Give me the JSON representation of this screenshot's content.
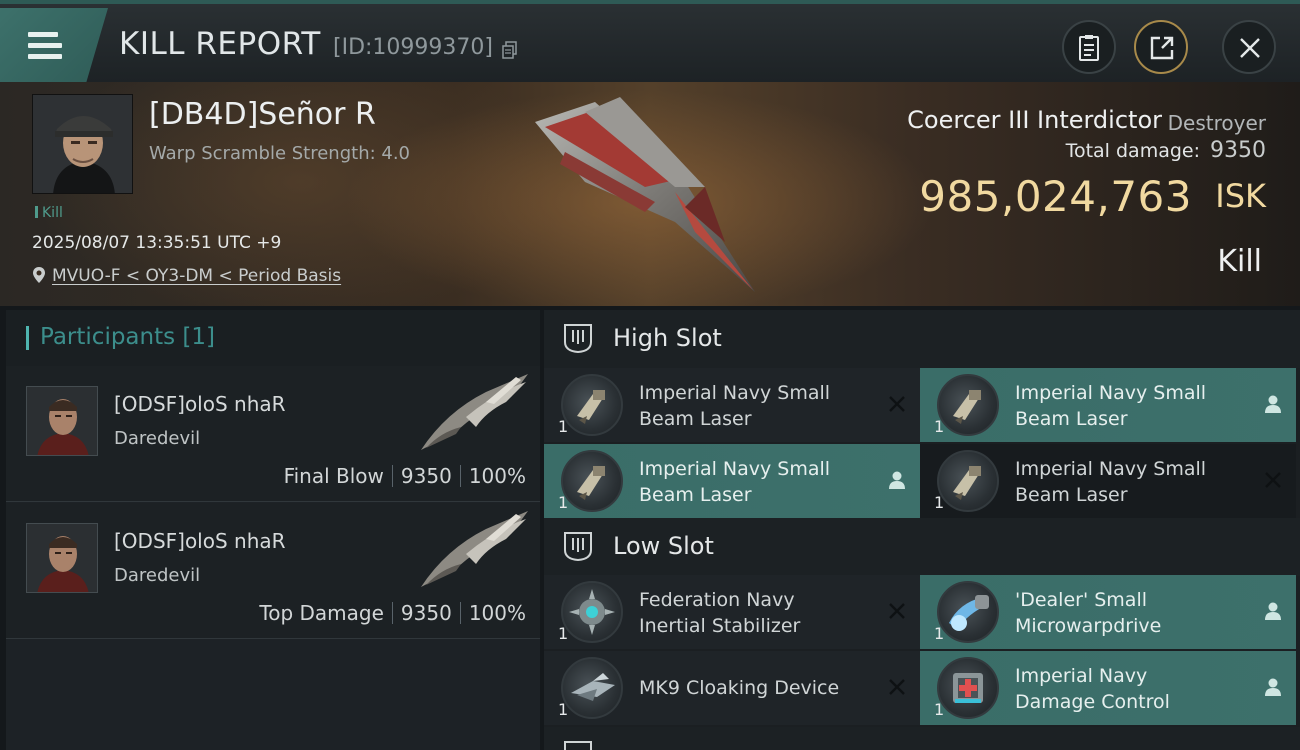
{
  "header": {
    "title": "KILL REPORT",
    "report_id": "[ID:10999370]"
  },
  "victim": {
    "name": "[DB4D]Señor R",
    "warp_scramble": "Warp Scramble Strength: 4.0",
    "tag": "Kill",
    "datetime": "2025/08/07 13:35:51 UTC +9",
    "location": "MVUO-F < OY3-DM < Period Basis",
    "ship_name": "Coercer III Interdictor",
    "ship_class": "Destroyer",
    "total_damage_label": "Total damage:",
    "total_damage": "9350",
    "isk_value": "985,024,763",
    "isk_unit": "ISK",
    "report_type": "Kill"
  },
  "participants": {
    "header": "Participants [1]",
    "rows": [
      {
        "name": "[ODSF]oloS nhaR",
        "ship": "Daredevil",
        "stat_label": "Final Blow",
        "damage": "9350",
        "percent": "100%"
      },
      {
        "name": "[ODSF]oloS nhaR",
        "ship": "Daredevil",
        "stat_label": "Top Damage",
        "damage": "9350",
        "percent": "100%"
      }
    ]
  },
  "fittings": {
    "high_slot": {
      "label": "High Slot",
      "modules": [
        {
          "line1": "Imperial Navy Small",
          "line2": "Beam Laser",
          "qty": "1",
          "status": "destroyed"
        },
        {
          "line1": "Imperial Navy Small",
          "line2": "Beam Laser",
          "qty": "1",
          "status": "dropped"
        },
        {
          "line1": "Imperial Navy Small",
          "line2": "Beam Laser",
          "qty": "1",
          "status": "dropped"
        },
        {
          "line1": "Imperial Navy Small",
          "line2": "Beam Laser",
          "qty": "1",
          "status": "destroyed"
        }
      ]
    },
    "low_slot": {
      "label": "Low Slot",
      "modules": [
        {
          "line1": "Federation Navy",
          "line2": "Inertial Stabilizer",
          "qty": "1",
          "status": "destroyed"
        },
        {
          "line1": "'Dealer' Small",
          "line2": "Microwarpdrive",
          "qty": "1",
          "status": "dropped"
        },
        {
          "line1": "MK9 Cloaking Device",
          "line2": "",
          "qty": "1",
          "status": "destroyed"
        },
        {
          "line1": "Imperial Navy",
          "line2": "Damage Control",
          "qty": "1",
          "status": "dropped"
        }
      ]
    }
  },
  "colors": {
    "accent_teal": "#3d706b",
    "isk_gold": "#f1d9a0"
  }
}
